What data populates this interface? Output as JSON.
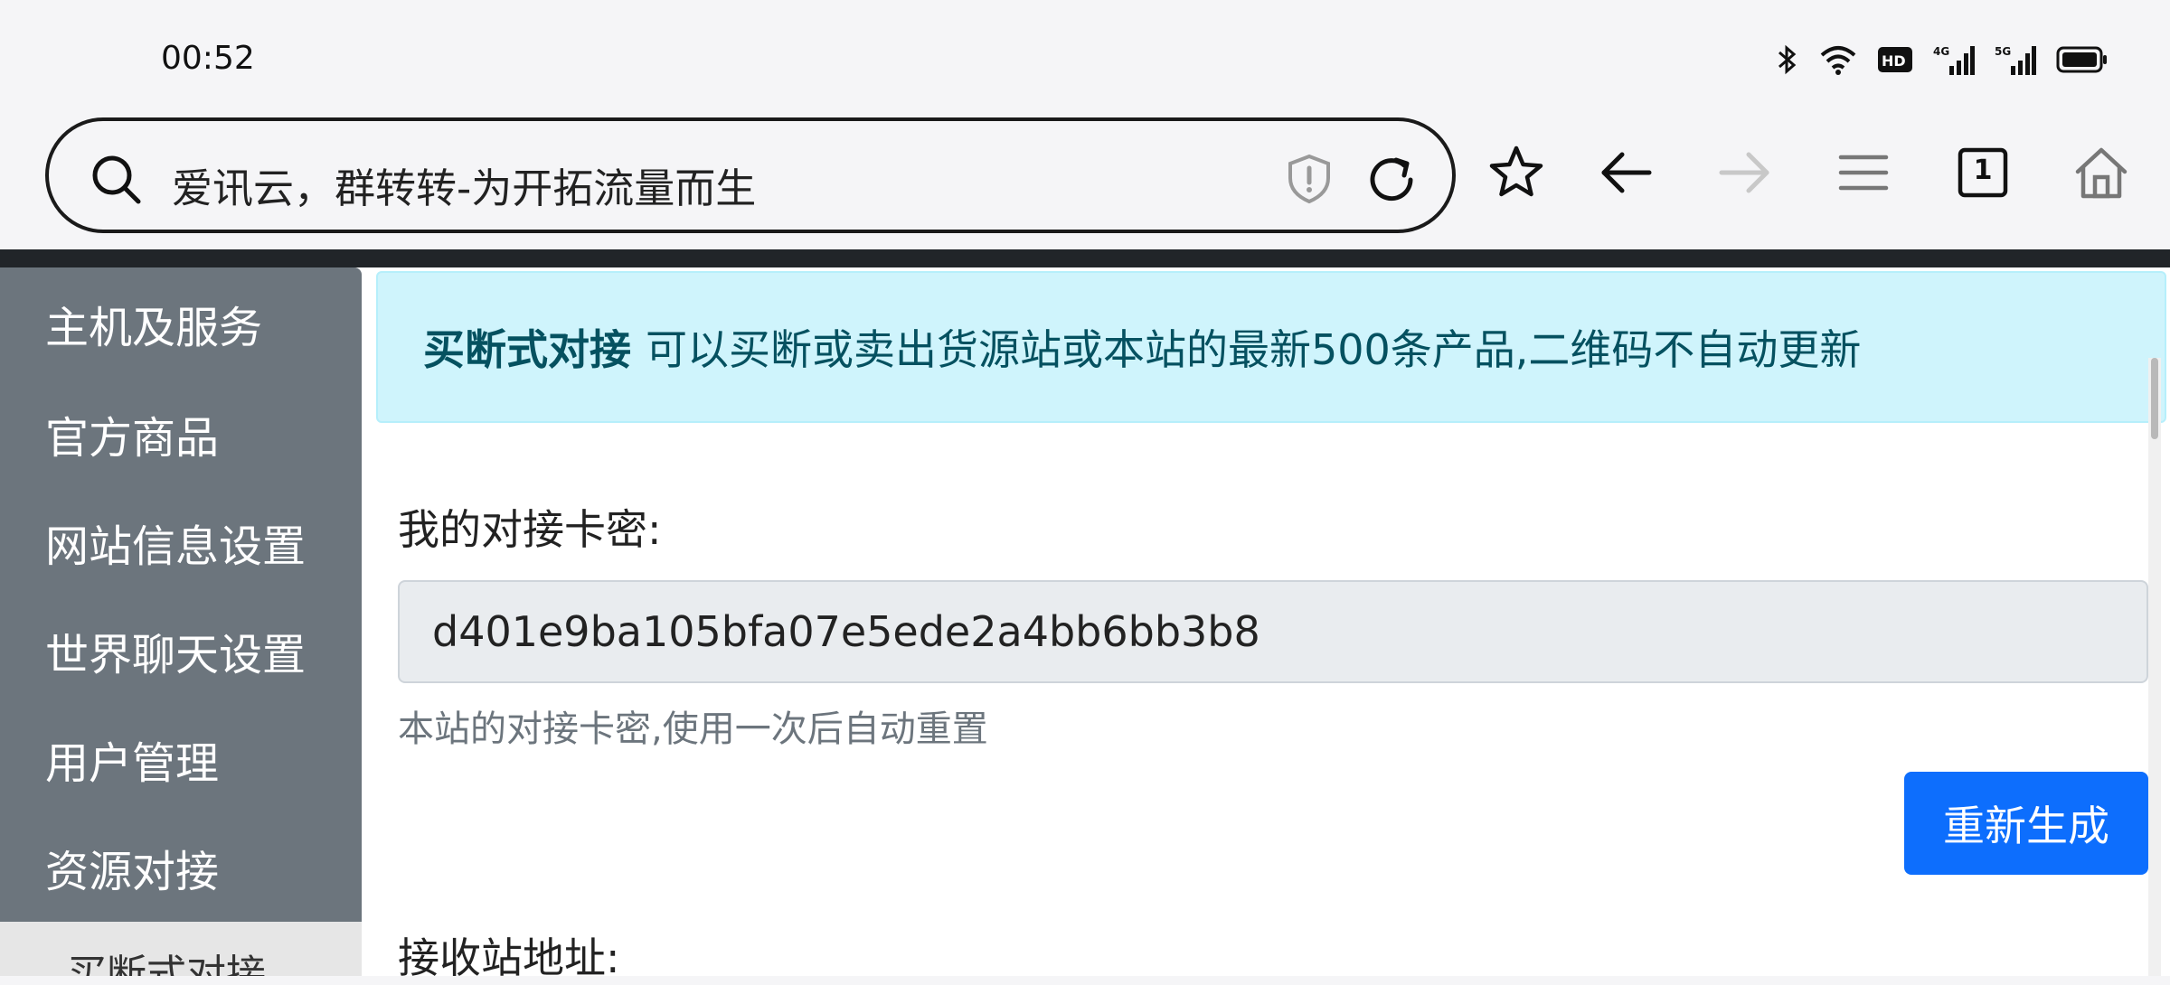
{
  "status_bar": {
    "time": "00:52",
    "icons": [
      "bluetooth-icon",
      "wifi-icon",
      "hd-icon",
      "signal-4g-icon",
      "signal-5g-icon",
      "battery-icon"
    ]
  },
  "browser": {
    "url_text": "爱讯云，群转转-为开拓流量而生",
    "tab_count": "1",
    "icons": [
      "search-icon",
      "shield-icon",
      "reload-icon",
      "star-icon",
      "back-arrow-icon",
      "forward-arrow-icon",
      "menu-icon",
      "tabs-icon",
      "home-icon"
    ]
  },
  "sidebar": {
    "items": [
      {
        "label": "主机及服务"
      },
      {
        "label": "官方商品"
      },
      {
        "label": "网站信息设置"
      },
      {
        "label": "世界聊天设置"
      },
      {
        "label": "用户管理"
      },
      {
        "label": "资源对接"
      }
    ],
    "sub_item": "买断式对接"
  },
  "alert": {
    "title": "买断式对接",
    "text": "可以买断或卖出货源站或本站的最新500条产品,二维码不自动更新"
  },
  "form": {
    "key_label": "我的对接卡密:",
    "key_value": "d401e9ba105bfa07e5ede2a4bb6bb3b8",
    "key_help": "本站的对接卡密,使用一次后自动重置",
    "regen_button": "重新生成",
    "receiver_label": "接收站地址:"
  },
  "colors": {
    "sidebar_bg": "#6c757d",
    "alert_bg": "#cff4fc",
    "alert_text": "#055160",
    "primary": "#0d6efd"
  }
}
